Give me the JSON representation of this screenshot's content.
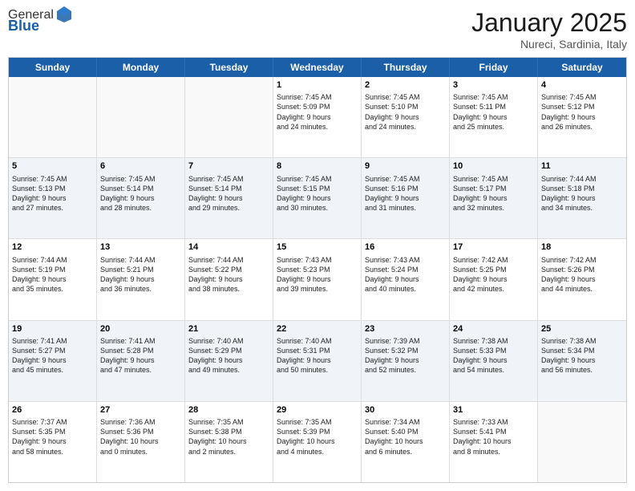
{
  "header": {
    "logo_general": "General",
    "logo_blue": "Blue",
    "month": "January 2025",
    "location": "Nureci, Sardinia, Italy"
  },
  "days_of_week": [
    "Sunday",
    "Monday",
    "Tuesday",
    "Wednesday",
    "Thursday",
    "Friday",
    "Saturday"
  ],
  "rows": [
    [
      {
        "day": "",
        "text": "",
        "empty": true
      },
      {
        "day": "",
        "text": "",
        "empty": true
      },
      {
        "day": "",
        "text": "",
        "empty": true
      },
      {
        "day": "1",
        "text": "Sunrise: 7:45 AM\nSunset: 5:09 PM\nDaylight: 9 hours\nand 24 minutes."
      },
      {
        "day": "2",
        "text": "Sunrise: 7:45 AM\nSunset: 5:10 PM\nDaylight: 9 hours\nand 24 minutes."
      },
      {
        "day": "3",
        "text": "Sunrise: 7:45 AM\nSunset: 5:11 PM\nDaylight: 9 hours\nand 25 minutes."
      },
      {
        "day": "4",
        "text": "Sunrise: 7:45 AM\nSunset: 5:12 PM\nDaylight: 9 hours\nand 26 minutes."
      }
    ],
    [
      {
        "day": "5",
        "text": "Sunrise: 7:45 AM\nSunset: 5:13 PM\nDaylight: 9 hours\nand 27 minutes."
      },
      {
        "day": "6",
        "text": "Sunrise: 7:45 AM\nSunset: 5:14 PM\nDaylight: 9 hours\nand 28 minutes."
      },
      {
        "day": "7",
        "text": "Sunrise: 7:45 AM\nSunset: 5:14 PM\nDaylight: 9 hours\nand 29 minutes."
      },
      {
        "day": "8",
        "text": "Sunrise: 7:45 AM\nSunset: 5:15 PM\nDaylight: 9 hours\nand 30 minutes."
      },
      {
        "day": "9",
        "text": "Sunrise: 7:45 AM\nSunset: 5:16 PM\nDaylight: 9 hours\nand 31 minutes."
      },
      {
        "day": "10",
        "text": "Sunrise: 7:45 AM\nSunset: 5:17 PM\nDaylight: 9 hours\nand 32 minutes."
      },
      {
        "day": "11",
        "text": "Sunrise: 7:44 AM\nSunset: 5:18 PM\nDaylight: 9 hours\nand 34 minutes."
      }
    ],
    [
      {
        "day": "12",
        "text": "Sunrise: 7:44 AM\nSunset: 5:19 PM\nDaylight: 9 hours\nand 35 minutes."
      },
      {
        "day": "13",
        "text": "Sunrise: 7:44 AM\nSunset: 5:21 PM\nDaylight: 9 hours\nand 36 minutes."
      },
      {
        "day": "14",
        "text": "Sunrise: 7:44 AM\nSunset: 5:22 PM\nDaylight: 9 hours\nand 38 minutes."
      },
      {
        "day": "15",
        "text": "Sunrise: 7:43 AM\nSunset: 5:23 PM\nDaylight: 9 hours\nand 39 minutes."
      },
      {
        "day": "16",
        "text": "Sunrise: 7:43 AM\nSunset: 5:24 PM\nDaylight: 9 hours\nand 40 minutes."
      },
      {
        "day": "17",
        "text": "Sunrise: 7:42 AM\nSunset: 5:25 PM\nDaylight: 9 hours\nand 42 minutes."
      },
      {
        "day": "18",
        "text": "Sunrise: 7:42 AM\nSunset: 5:26 PM\nDaylight: 9 hours\nand 44 minutes."
      }
    ],
    [
      {
        "day": "19",
        "text": "Sunrise: 7:41 AM\nSunset: 5:27 PM\nDaylight: 9 hours\nand 45 minutes."
      },
      {
        "day": "20",
        "text": "Sunrise: 7:41 AM\nSunset: 5:28 PM\nDaylight: 9 hours\nand 47 minutes."
      },
      {
        "day": "21",
        "text": "Sunrise: 7:40 AM\nSunset: 5:29 PM\nDaylight: 9 hours\nand 49 minutes."
      },
      {
        "day": "22",
        "text": "Sunrise: 7:40 AM\nSunset: 5:31 PM\nDaylight: 9 hours\nand 50 minutes."
      },
      {
        "day": "23",
        "text": "Sunrise: 7:39 AM\nSunset: 5:32 PM\nDaylight: 9 hours\nand 52 minutes."
      },
      {
        "day": "24",
        "text": "Sunrise: 7:38 AM\nSunset: 5:33 PM\nDaylight: 9 hours\nand 54 minutes."
      },
      {
        "day": "25",
        "text": "Sunrise: 7:38 AM\nSunset: 5:34 PM\nDaylight: 9 hours\nand 56 minutes."
      }
    ],
    [
      {
        "day": "26",
        "text": "Sunrise: 7:37 AM\nSunset: 5:35 PM\nDaylight: 9 hours\nand 58 minutes."
      },
      {
        "day": "27",
        "text": "Sunrise: 7:36 AM\nSunset: 5:36 PM\nDaylight: 10 hours\nand 0 minutes."
      },
      {
        "day": "28",
        "text": "Sunrise: 7:35 AM\nSunset: 5:38 PM\nDaylight: 10 hours\nand 2 minutes."
      },
      {
        "day": "29",
        "text": "Sunrise: 7:35 AM\nSunset: 5:39 PM\nDaylight: 10 hours\nand 4 minutes."
      },
      {
        "day": "30",
        "text": "Sunrise: 7:34 AM\nSunset: 5:40 PM\nDaylight: 10 hours\nand 6 minutes."
      },
      {
        "day": "31",
        "text": "Sunrise: 7:33 AM\nSunset: 5:41 PM\nDaylight: 10 hours\nand 8 minutes."
      },
      {
        "day": "",
        "text": "",
        "empty": true
      }
    ]
  ]
}
